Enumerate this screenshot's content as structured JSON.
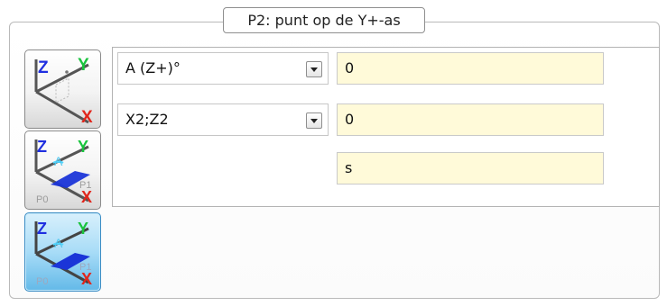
{
  "group": {
    "title": "P2: punt op de Y+-as"
  },
  "buttons": [
    {
      "name": "plane-mode-1",
      "selected": false,
      "axes": {
        "z": "Z",
        "y": "Y",
        "x": "X"
      },
      "points": {
        "p0": "",
        "p1": ""
      }
    },
    {
      "name": "plane-mode-2",
      "selected": false,
      "axes": {
        "z": "Z",
        "y": "Y",
        "x": "X"
      },
      "labels": {
        "a": "A",
        "p0": "P0",
        "p1": "P1"
      }
    },
    {
      "name": "plane-mode-3",
      "selected": true,
      "axes": {
        "z": "Z",
        "y": "Y",
        "x": "X"
      },
      "labels": {
        "a": "A",
        "p0": "P0",
        "p1": "P1"
      }
    }
  ],
  "fields": {
    "row1": {
      "selector": "A (Z+)°",
      "value": "0"
    },
    "row2": {
      "selector": "X2;Z2",
      "value": "0"
    },
    "row3": {
      "value": "s"
    }
  },
  "colors": {
    "axis_z": "#1f2fe0",
    "axis_y": "#19c43d",
    "axis_x": "#e1261c",
    "plane": "#1b35d8",
    "value_bg": "#fffad9",
    "active_button": "#63b9e8"
  }
}
